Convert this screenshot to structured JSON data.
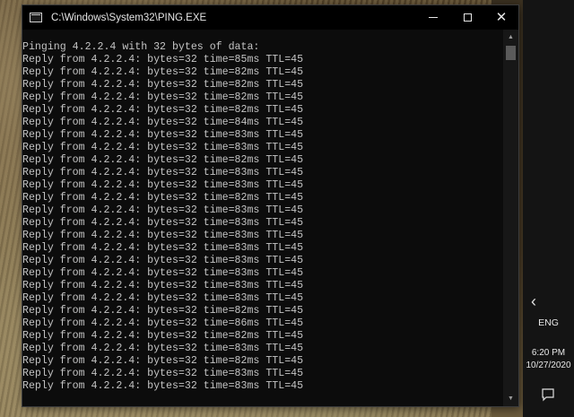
{
  "window": {
    "title": "C:\\Windows\\System32\\PING.EXE",
    "controls": {
      "minimize": "minimize-icon",
      "maximize": "maximize-icon",
      "close": "close-icon"
    }
  },
  "console": {
    "lines": [
      "Pinging 4.2.2.4 with 32 bytes of data:",
      "Reply from 4.2.2.4: bytes=32 time=85ms TTL=45",
      "Reply from 4.2.2.4: bytes=32 time=82ms TTL=45",
      "Reply from 4.2.2.4: bytes=32 time=82ms TTL=45",
      "Reply from 4.2.2.4: bytes=32 time=82ms TTL=45",
      "Reply from 4.2.2.4: bytes=32 time=82ms TTL=45",
      "Reply from 4.2.2.4: bytes=32 time=84ms TTL=45",
      "Reply from 4.2.2.4: bytes=32 time=83ms TTL=45",
      "Reply from 4.2.2.4: bytes=32 time=83ms TTL=45",
      "Reply from 4.2.2.4: bytes=32 time=82ms TTL=45",
      "Reply from 4.2.2.4: bytes=32 time=83ms TTL=45",
      "Reply from 4.2.2.4: bytes=32 time=83ms TTL=45",
      "Reply from 4.2.2.4: bytes=32 time=82ms TTL=45",
      "Reply from 4.2.2.4: bytes=32 time=83ms TTL=45",
      "Reply from 4.2.2.4: bytes=32 time=83ms TTL=45",
      "Reply from 4.2.2.4: bytes=32 time=83ms TTL=45",
      "Reply from 4.2.2.4: bytes=32 time=83ms TTL=45",
      "Reply from 4.2.2.4: bytes=32 time=83ms TTL=45",
      "Reply from 4.2.2.4: bytes=32 time=83ms TTL=45",
      "Reply from 4.2.2.4: bytes=32 time=83ms TTL=45",
      "Reply from 4.2.2.4: bytes=32 time=83ms TTL=45",
      "Reply from 4.2.2.4: bytes=32 time=82ms TTL=45",
      "Reply from 4.2.2.4: bytes=32 time=86ms TTL=45",
      "Reply from 4.2.2.4: bytes=32 time=82ms TTL=45",
      "Reply from 4.2.2.4: bytes=32 time=83ms TTL=45",
      "Reply from 4.2.2.4: bytes=32 time=82ms TTL=45",
      "Reply from 4.2.2.4: bytes=32 time=83ms TTL=45",
      "Reply from 4.2.2.4: bytes=32 time=83ms TTL=45"
    ]
  },
  "taskbar": {
    "chevron_icon": "chevron-left-icon",
    "language": "ENG",
    "time": "6:20 PM",
    "date": "10/27/2020",
    "notification_icon": "action-center-icon"
  },
  "colors": {
    "console_background": "#0c0c0c",
    "console_text": "#c4c4c4",
    "taskbar_background": "#141414"
  }
}
